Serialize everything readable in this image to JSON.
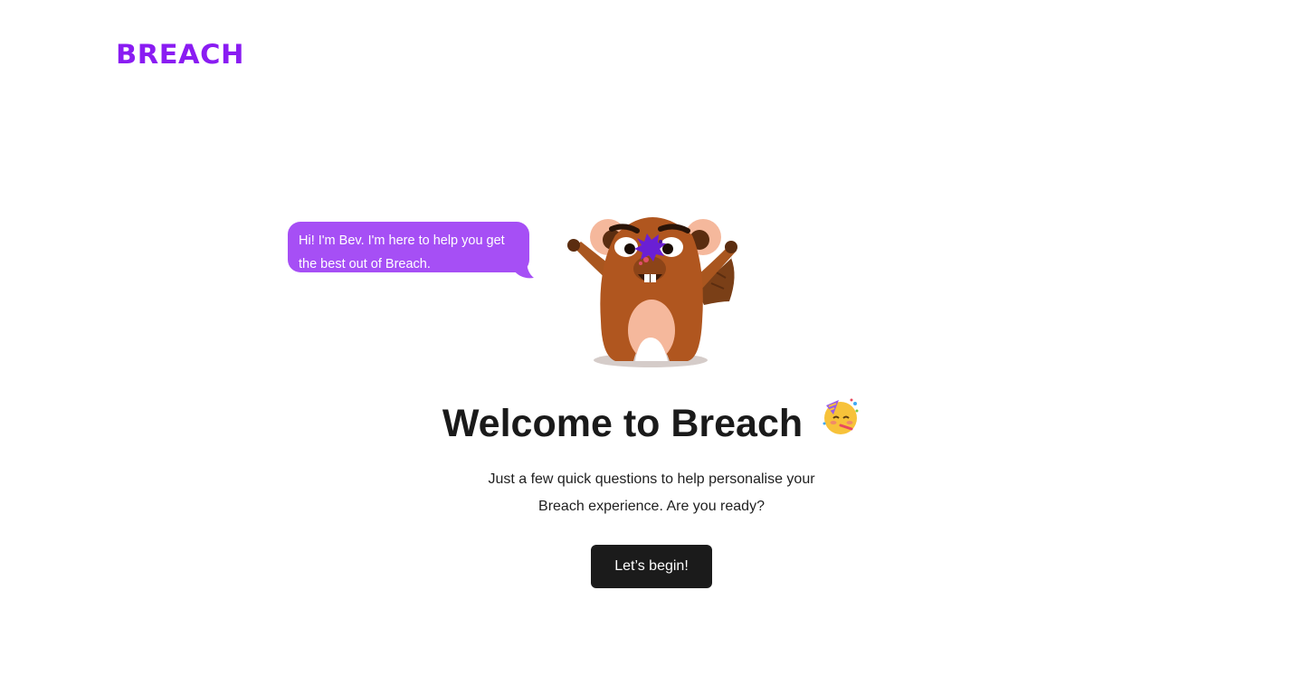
{
  "brand": {
    "logo_text": "BREACH",
    "accent_color": "#8a1cf2",
    "bubble_color": "#a64ff5"
  },
  "mascot": {
    "speech": "Hi! I'm Bev. I'm here to help you get the best out of Breach.",
    "icon": "beaver-mascot-icon"
  },
  "welcome": {
    "title": "Welcome to Breach",
    "title_emoji_icon": "party-face-icon",
    "subtitle": "Just a few quick questions to help personalise your Breach experience. Are you ready?"
  },
  "actions": {
    "begin_label": "Let’s begin!",
    "button_color": "#1b1b1b"
  }
}
